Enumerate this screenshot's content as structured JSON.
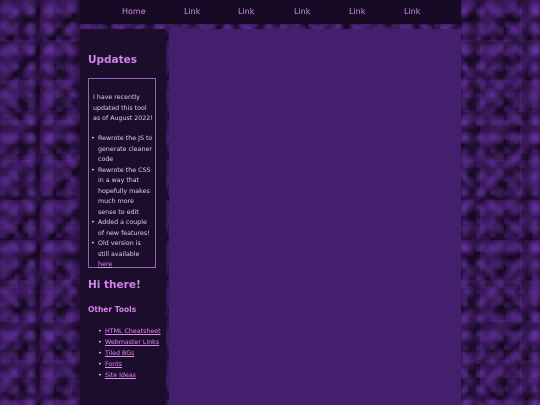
{
  "nav": {
    "items": [
      "Home",
      "Link",
      "Link",
      "Link",
      "Link",
      "Link"
    ]
  },
  "sidebar": {
    "updates_title": "Updates",
    "updates_intro": "I have recently updated this tool as of August 2022!",
    "updates_items": [
      "Rewrote the JS to generate cleaner code",
      "Rewrote the CSS in a way that hopefully makes much more sense to edit",
      "Added a couple of new features!",
      "Old version is still available"
    ],
    "old_version_link": "here",
    "hi_title": "Hi there!",
    "tools_title": "Other Tools",
    "tools": [
      "HTML Cheatsheet",
      "Webmaster Links",
      "Tiled BGs",
      "Fonts",
      "Site Ideas"
    ]
  },
  "colors": {
    "nav_bg": "#160a25",
    "sidebar_bg": "#1c0d2d",
    "main_bg": "#431f6e",
    "accent": "#d383e9",
    "text": "#ddd3e7"
  }
}
